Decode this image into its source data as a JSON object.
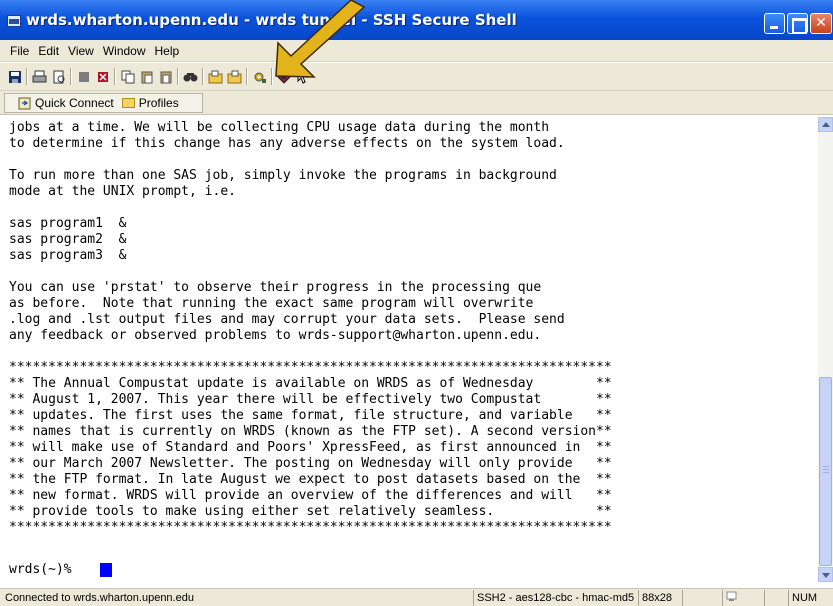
{
  "window": {
    "title": "wrds.wharton.upenn.edu - wrds tunnel - SSH Secure Shell",
    "close_glyph": "✕"
  },
  "menu": [
    "File",
    "Edit",
    "View",
    "Window",
    "Help"
  ],
  "toolbar": {
    "icons": [
      "save-icon",
      "print-icon",
      "print-preview-icon",
      "cut-icon",
      "delete-icon",
      "copy-icon",
      "paste-icon",
      "paste-special-icon",
      "find-icon",
      "file-transfer-icon",
      "new-file-transfer-icon",
      "settings-icon",
      "profiles-icon",
      "help-icon"
    ]
  },
  "profile_bar": {
    "quick_connect": "Quick Connect",
    "profiles": "Profiles"
  },
  "terminal": {
    "lines": [
      "jobs at a time. We will be collecting CPU usage data during the month",
      "to determine if this change has any adverse effects on the system load.",
      "",
      "To run more than one SAS job, simply invoke the programs in background",
      "mode at the UNIX prompt, i.e.",
      "",
      "sas program1  &",
      "sas program2  &",
      "sas program3  &",
      "",
      "You can use 'prstat' to observe their progress in the processing que",
      "as before.  Note that running the exact same program will overwrite",
      ".log and .lst output files and may corrupt your data sets.  Please send",
      "any feedback or observed problems to wrds-support@wharton.upenn.edu.",
      "",
      "*****************************************************************************",
      "** The Annual Compustat update is available on WRDS as of Wednesday        **",
      "** August 1, 2007. This year there will be effectively two Compustat       **",
      "** updates. The first uses the same format, file structure, and variable   **",
      "** names that is currently on WRDS (known as the FTP set). A second version**",
      "** will make use of Standard and Poors' XpressFeed, as first announced in  **",
      "** our March 2007 Newsletter. The posting on Wednesday will only provide   **",
      "** the FTP format. In late August we expect to post datasets based on the  **",
      "** new format. WRDS will provide an overview of the differences and will   **",
      "** provide tools to make using either set relatively seamless.             **",
      "*****************************************************************************",
      "",
      "wrds(~)% "
    ]
  },
  "status_bar": {
    "connection": "Connected to wrds.wharton.upenn.edu",
    "cipher": "SSH2 - aes128-cbc - hmac-md5",
    "size": "88x28",
    "num": "NUM"
  }
}
